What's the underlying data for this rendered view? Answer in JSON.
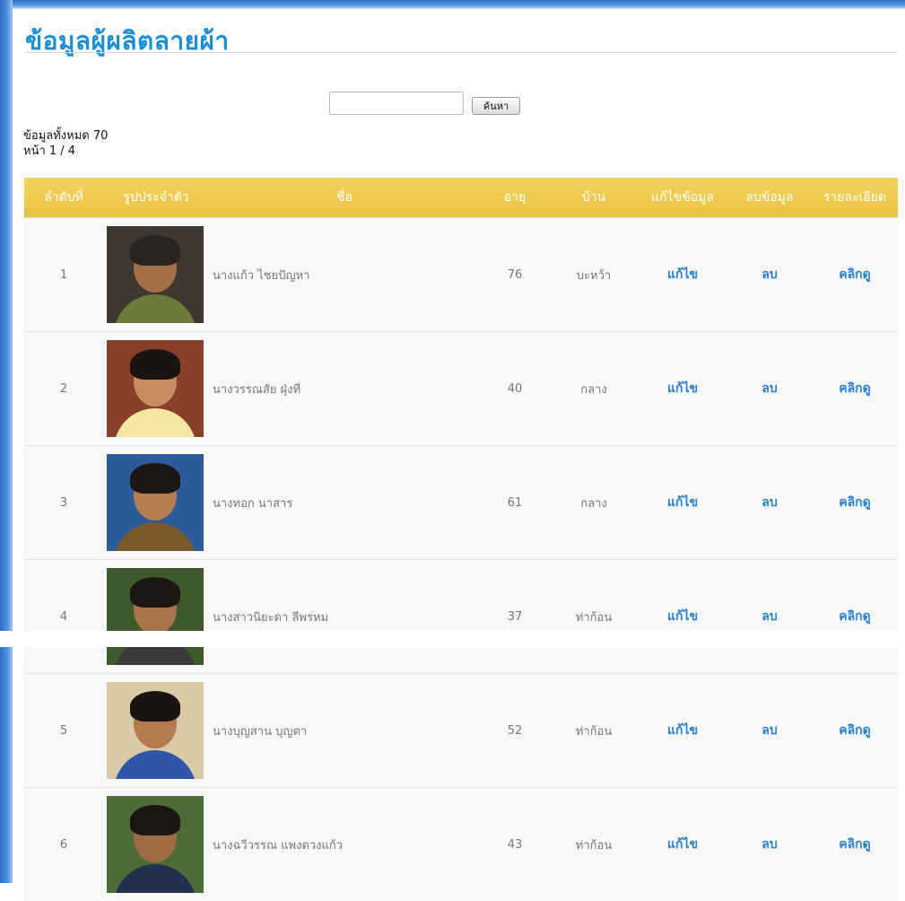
{
  "page": {
    "title": "ข้อมูลผู้ผลิตลายผ้า",
    "search": {
      "value": "",
      "placeholder": "",
      "button_label": "ค้นหา"
    },
    "total_text": "ข้อมูลทั้งหมด 70",
    "page_text": "หน้า 1 / 4"
  },
  "colors": {
    "title": "#1a8fd8",
    "header": "#eec84b",
    "link": "#2a7fd0",
    "frame": "#2f6fc6"
  },
  "table": {
    "headers": {
      "no": "ลำดับที่",
      "photo": "รูปประจำตัว",
      "name": "ชื่อ",
      "age": "อายุ",
      "village": "บ้าน",
      "edit": "แก้ไขข้อมูล",
      "delete": "ลบข้อมูล",
      "detail": "รายละเอียด"
    },
    "rows": [
      {
        "no": "1",
        "name": "นางแก้ว ไชยปัญหา",
        "age": "76",
        "village": "บะหว้า",
        "edit": "แก้ไข",
        "delete": "ลบ",
        "detail": "คลิกดู",
        "photo": {
          "bg": "#40382f",
          "skin": "#a4704a",
          "hair": "#2a2520",
          "shirt": "#6c7b3c"
        }
      },
      {
        "no": "2",
        "name": "นางวรรณสัย ฝุ่งที",
        "age": "40",
        "village": "กลาง",
        "edit": "แก้ไข",
        "delete": "ลบ",
        "detail": "คลิกดู",
        "photo": {
          "bg": "#8a3f2a",
          "skin": "#c98b5f",
          "hair": "#1a1512",
          "shirt": "#f4e7a2"
        }
      },
      {
        "no": "3",
        "name": "นางทอก นาสาร",
        "age": "61",
        "village": "กลาง",
        "edit": "แก้ไข",
        "delete": "ลบ",
        "detail": "คลิกดู",
        "photo": {
          "bg": "#2d5a9a",
          "skin": "#b57e52",
          "hair": "#1c1714",
          "shirt": "#7a5a2c"
        }
      },
      {
        "no": "4",
        "name": "นางสาวนิยะดา ลีพรหม",
        "age": "37",
        "village": "ท่าก้อน",
        "edit": "แก้ไข",
        "delete": "ลบ",
        "detail": "คลิกดู",
        "photo": {
          "bg": "#3f5a2a",
          "skin": "#a8744c",
          "hair": "#1d1713",
          "shirt": "#3b3b3b"
        }
      },
      {
        "no": "5",
        "name": "นางบุญสาน บุญตา",
        "age": "52",
        "village": "ท่าก้อน",
        "edit": "แก้ไข",
        "delete": "ลบ",
        "detail": "คลิกดู",
        "photo": {
          "bg": "#d9c9a6",
          "skin": "#b27a4e",
          "hair": "#1a1512",
          "shirt": "#2f56a8"
        }
      },
      {
        "no": "6",
        "name": "นางฉวีวรรณ แพงดวงแก้ว",
        "age": "43",
        "village": "ท่าก้อน",
        "edit": "แก้ไข",
        "delete": "ลบ",
        "detail": "คลิกดู",
        "photo": {
          "bg": "#4d6b35",
          "skin": "#9f6b44",
          "hair": "#1b1612",
          "shirt": "#23304f"
        }
      }
    ]
  }
}
